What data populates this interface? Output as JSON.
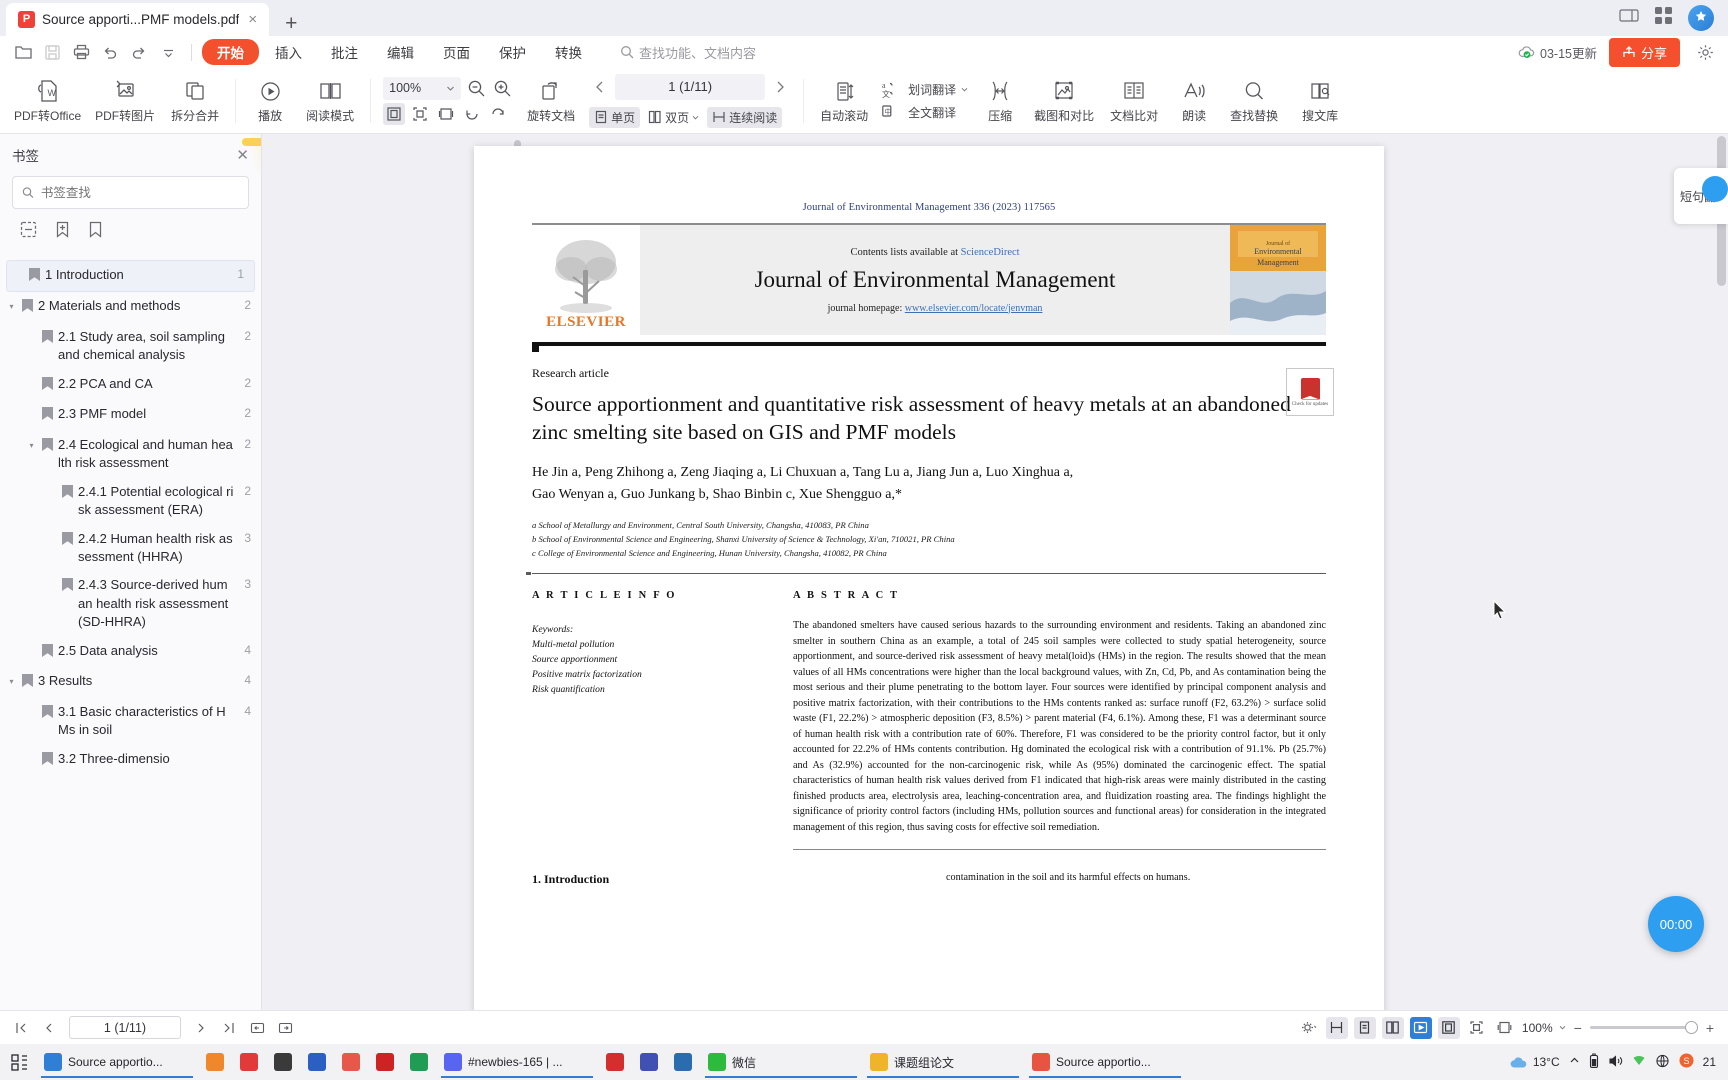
{
  "window": {
    "tab_title": "Source apporti...PMF models.pdf",
    "tab_icon_letter": "P",
    "new_tab_label": "+",
    "close_label": "×"
  },
  "menu": {
    "quick": [
      "open-icon",
      "save-icon",
      "print-icon",
      "undo-icon",
      "redo-icon",
      "customize-icon"
    ],
    "tabs": [
      {
        "label": "开始",
        "active": true
      },
      {
        "label": "插入",
        "active": false
      },
      {
        "label": "批注",
        "active": false
      },
      {
        "label": "编辑",
        "active": false
      },
      {
        "label": "页面",
        "active": false
      },
      {
        "label": "保护",
        "active": false
      },
      {
        "label": "转换",
        "active": false
      }
    ],
    "search_placeholder": "查找功能、文档内容",
    "cloud_status": "03-15更新",
    "share_label": "分享",
    "settings_icon": "gear-icon"
  },
  "ribbon": {
    "items": [
      {
        "label": "PDF转Office",
        "icon": "pdf-to-word-icon",
        "dropdown": true
      },
      {
        "label": "PDF转图片",
        "icon": "pdf-to-image-icon",
        "dropdown": false
      },
      {
        "label": "拆分合并",
        "icon": "split-merge-icon",
        "dropdown": true
      },
      {
        "label": "播放",
        "icon": "play-icon",
        "dropdown": false
      },
      {
        "label": "阅读模式",
        "icon": "book-icon",
        "dropdown": false
      }
    ],
    "zoom_value": "100%",
    "zoom_tools": [
      "fit-page-icon",
      "fit-width-icon",
      "fit-visible-icon",
      "rotate-ccw-icon",
      "rotate-cw-icon"
    ],
    "zoom_out_icon": "zoom-out-icon",
    "zoom_in_icon": "zoom-in-icon",
    "rotate_doc_label": "旋转文档",
    "page_indicator": "1 (1/11)",
    "prev_page_icon": "chevron-left-icon",
    "next_page_icon": "chevron-right-icon",
    "view_modes": [
      {
        "label": "单页",
        "selected": true,
        "dropdown": false
      },
      {
        "label": "双页",
        "selected": false,
        "dropdown": true
      },
      {
        "label": "连续阅读",
        "selected": true,
        "dropdown": false
      }
    ],
    "auto_scroll_label": "自动滚动",
    "translate_word_label": "划词翻译",
    "translate_full_label": "全文翻译",
    "right_items": [
      {
        "label": "压缩",
        "icon": "compress-icon"
      },
      {
        "label": "截图和对比",
        "icon": "screenshot-compare-icon"
      },
      {
        "label": "文档比对",
        "icon": "doc-compare-icon"
      },
      {
        "label": "朗读",
        "icon": "read-aloud-icon"
      },
      {
        "label": "查找替换",
        "icon": "find-replace-icon"
      },
      {
        "label": "搜文库",
        "icon": "search-library-icon"
      }
    ]
  },
  "sidepanel": {
    "title": "书签",
    "close_icon": "close-icon",
    "search_placeholder": "书签查找",
    "search_value": "",
    "tools": [
      "collapse-all-icon",
      "add-bookmark-icon",
      "bookmark-icon"
    ],
    "bookmarks": [
      {
        "label": "1 Introduction",
        "page": "1",
        "indent": 0,
        "expandable": false,
        "selected": true
      },
      {
        "label": "2 Materials and methods",
        "page": "2",
        "indent": 0,
        "expandable": true,
        "selected": false
      },
      {
        "label": "2.1 Study area, soil sampling and chemical analysis",
        "page": "2",
        "indent": 1,
        "expandable": false,
        "selected": false
      },
      {
        "label": "2.2 PCA and CA",
        "page": "2",
        "indent": 1,
        "expandable": false,
        "selected": false
      },
      {
        "label": "2.3 PMF model",
        "page": "2",
        "indent": 1,
        "expandable": false,
        "selected": false
      },
      {
        "label": "2.4 Ecological and human health risk assessment",
        "page": "2",
        "indent": 1,
        "expandable": true,
        "selected": false
      },
      {
        "label": "2.4.1 Potential ecological risk assessment (ERA)",
        "page": "2",
        "indent": 2,
        "expandable": false,
        "selected": false
      },
      {
        "label": "2.4.2 Human health risk assessment (HHRA)",
        "page": "3",
        "indent": 2,
        "expandable": false,
        "selected": false
      },
      {
        "label": "2.4.3 Source-derived human health risk assessment (SD-HHRA)",
        "page": "3",
        "indent": 2,
        "expandable": false,
        "selected": false
      },
      {
        "label": "2.5 Data analysis",
        "page": "4",
        "indent": 1,
        "expandable": false,
        "selected": false
      },
      {
        "label": "3 Results",
        "page": "4",
        "indent": 0,
        "expandable": true,
        "selected": false
      },
      {
        "label": "3.1 Basic characteristics of HMs in soil",
        "page": "4",
        "indent": 1,
        "expandable": false,
        "selected": false
      },
      {
        "label": "3.2 Three-dimensio",
        "page": "",
        "indent": 1,
        "expandable": false,
        "selected": false
      }
    ]
  },
  "document": {
    "journal_line": "Journal of Environmental Management 336 (2023) 117565",
    "contents_prefix": "Contents lists available at ",
    "contents_link": "ScienceDirect",
    "journal_title": "Journal of Environmental Management",
    "homepage_prefix": "journal homepage: ",
    "homepage_link": "www.elsevier.com/locate/jenvman",
    "publisher": "ELSEVIER",
    "article_type": "Research article",
    "title": "Source apportionment and quantitative risk assessment of heavy metals at an abandoned zinc smelting site based on GIS and PMF models",
    "authors_line1": "He Jin a, Peng Zhihong a, Zeng Jiaqing a, Li Chuxuan a, Tang Lu a, Jiang Jun a, Luo Xinghua a,",
    "authors_line2": "Gao Wenyan a, Guo Junkang b, Shao Binbin c, Xue Shengguo a,*",
    "affiliations": [
      "a School of Metallurgy and Environment, Central South University, Changsha, 410083, PR China",
      "b School of Environmental Science and Engineering, Shanxi University of Science & Technology, Xi'an, 710021, PR China",
      "c College of Environmental Science and Engineering, Hunan University, Changsha, 410082, PR China"
    ],
    "article_info_head": "A R T I C L E  I N F O",
    "abstract_head": "A B S T R A C T",
    "keywords_label": "Keywords:",
    "keywords": [
      "Multi-metal pollution",
      "Source apportionment",
      "Positive matrix factorization",
      "Risk quantification"
    ],
    "abstract": "The abandoned smelters have caused serious hazards to the surrounding environment and residents. Taking an abandoned zinc smelter in southern China as an example, a total of 245 soil samples were collected to study spatial heterogeneity, source apportionment, and source-derived risk assessment of heavy metal(loid)s (HMs) in the region. The results showed that the mean values of all HMs concentrations were higher than the local background values, with Zn, Cd, Pb, and As contamination being the most serious and their plume penetrating to the bottom layer. Four sources were identified by principal component analysis and positive matrix factorization, with their contributions to the HMs contents ranked as: surface runoff (F2, 63.2%) > surface solid waste (F1, 22.2%) > atmospheric deposition (F3, 8.5%) > parent material (F4, 6.1%). Among these, F1 was a determinant source of human health risk with a contribution rate of 60%. Therefore, F1 was considered to be the priority control factor, but it only accounted for 22.2% of HMs contents contribution. Hg dominated the ecological risk with a contribution of 91.1%. Pb (25.7%) and As (32.9%) accounted for the non-carcinogenic risk, while As (95%) dominated the carcinogenic effect. The spatial characteristics of human health risk values derived from F1 indicated that high-risk areas were mainly distributed in the casting finished products area, electrolysis area, leaching-concentration area, and fluidization roasting area. The findings highlight the significance of priority control factors (including HMs, pollution sources and functional areas) for consideration in the integrated management of this region, thus saving costs for effective soil remediation.",
    "intro_head": "1.  Introduction",
    "intro_right_text": "contamination in the soil and its harmful effects on humans.",
    "check_updates_label": "Check for updates"
  },
  "statusbar": {
    "first_page_icon": "first-page-icon",
    "prev_page_icon": "prev-page-icon",
    "page_value": "1 (1/11)",
    "next_page_icon": "next-page-icon",
    "last_page_icon": "last-page-icon",
    "prev_view_icon": "prev-view-icon",
    "next_view_icon": "next-view-icon",
    "theme_icon": "brightness-icon",
    "continuous_icon": "continuous-scroll-icon",
    "single_page_icon": "single-page-icon",
    "two_page_icon": "two-page-icon",
    "presentation_icon": "presentation-icon",
    "fit_page_icon": "fit-page-icon",
    "fit_visible_icon": "fit-visible-icon",
    "fit_width_icon": "fit-width-icon",
    "zoom_value": "100%",
    "zoom_out_label": "−",
    "zoom_in_label": "+"
  },
  "taskbar": {
    "start_icon": "windows-start-icon",
    "items": [
      {
        "label": "Source apportio...",
        "color": "#2f7fd6",
        "open": true,
        "wide": true
      },
      {
        "label": "",
        "color": "#f0872b",
        "open": false,
        "wide": false
      },
      {
        "label": "",
        "color": "#e03a3a",
        "open": false,
        "wide": false
      },
      {
        "label": "",
        "color": "#3a3a3a",
        "open": false,
        "wide": false
      },
      {
        "label": "",
        "color": "#2b5fc4",
        "open": false,
        "wide": false
      },
      {
        "label": "",
        "color": "#e8584a",
        "open": false,
        "wide": false
      },
      {
        "label": "",
        "color": "#cf2222",
        "open": false,
        "wide": false
      },
      {
        "label": "",
        "color": "#1f9d55",
        "open": false,
        "wide": false
      },
      {
        "label": "#newbies-165 | ...",
        "color": "#5865f2",
        "open": true,
        "wide": true
      },
      {
        "label": "",
        "color": "#d32f2f",
        "open": false,
        "wide": false
      },
      {
        "label": "",
        "color": "#4050b5",
        "open": false,
        "wide": false
      },
      {
        "label": "",
        "color": "#2b6cb0",
        "open": false,
        "wide": false
      },
      {
        "label": "微信",
        "color": "#2dbb3d",
        "open": true,
        "wide": true
      },
      {
        "label": "课题组论文",
        "color": "#f0b429",
        "open": true,
        "wide": true
      },
      {
        "label": "Source apportio...",
        "color": "#e8543f",
        "open": true,
        "wide": true
      }
    ],
    "tray": {
      "weather_temp": "13°C",
      "weather_icon": "cloud-icon",
      "chevron_icon": "chevron-up-icon",
      "battery_icon": "battery-icon",
      "volume_icon": "volume-icon",
      "network_icon": "network-icon",
      "ime_icon": "ime-icon",
      "security_icon": "security-icon",
      "clock": "21"
    }
  },
  "overlays": {
    "timer_label": "00:00",
    "flyout_label": "短句翻"
  },
  "colors": {
    "accent": "#f4502d",
    "link": "#3f6fb5",
    "taskbar_active": "#2f7fd6",
    "sun": "#fcc419"
  }
}
